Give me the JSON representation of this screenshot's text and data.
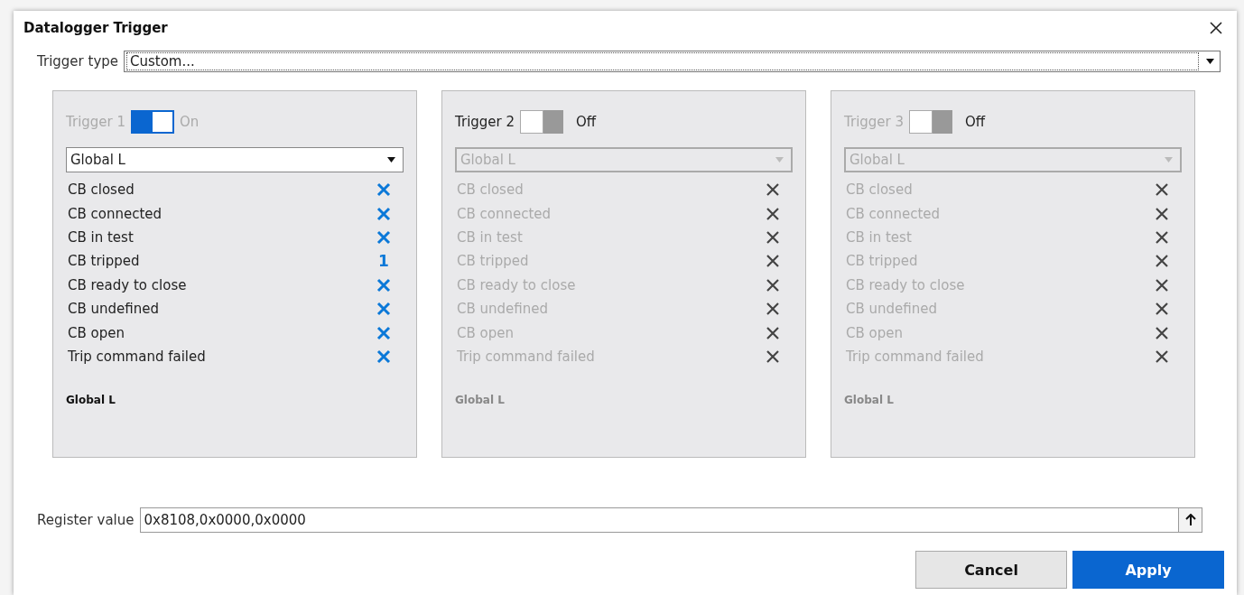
{
  "window": {
    "title": "Datalogger Trigger"
  },
  "trigger_type": {
    "label": "Trigger type",
    "value": "Custom..."
  },
  "triggers": [
    {
      "label": "Trigger 1",
      "label_active": false,
      "on": true,
      "state_text": "On",
      "source": "Global L",
      "conditions": [
        {
          "name": "CB closed",
          "kind": "x"
        },
        {
          "name": "CB connected",
          "kind": "x"
        },
        {
          "name": "CB in test",
          "kind": "x"
        },
        {
          "name": "CB tripped",
          "kind": "value",
          "value": "1"
        },
        {
          "name": "CB ready to close",
          "kind": "x"
        },
        {
          "name": "CB undefined",
          "kind": "x"
        },
        {
          "name": "CB open",
          "kind": "x"
        },
        {
          "name": "Trip command failed",
          "kind": "x"
        }
      ],
      "footer": "Global L"
    },
    {
      "label": "Trigger 2",
      "label_active": true,
      "on": false,
      "state_text": "Off",
      "source": "Global L",
      "conditions": [
        {
          "name": "CB closed",
          "kind": "x"
        },
        {
          "name": "CB connected",
          "kind": "x"
        },
        {
          "name": "CB in test",
          "kind": "x"
        },
        {
          "name": "CB tripped",
          "kind": "x"
        },
        {
          "name": "CB ready to close",
          "kind": "x"
        },
        {
          "name": "CB undefined",
          "kind": "x"
        },
        {
          "name": "CB open",
          "kind": "x"
        },
        {
          "name": "Trip command failed",
          "kind": "x"
        }
      ],
      "footer": "Global L"
    },
    {
      "label": "Trigger 3",
      "label_active": false,
      "on": false,
      "state_text": "Off",
      "source": "Global L",
      "conditions": [
        {
          "name": "CB closed",
          "kind": "x"
        },
        {
          "name": "CB connected",
          "kind": "x"
        },
        {
          "name": "CB in test",
          "kind": "x"
        },
        {
          "name": "CB tripped",
          "kind": "x"
        },
        {
          "name": "CB ready to close",
          "kind": "x"
        },
        {
          "name": "CB undefined",
          "kind": "x"
        },
        {
          "name": "CB open",
          "kind": "x"
        },
        {
          "name": "Trip command failed",
          "kind": "x"
        }
      ],
      "footer": "Global L"
    }
  ],
  "register": {
    "label": "Register value",
    "value": "0x8108,0x0000,0x0000"
  },
  "buttons": [
    {
      "label": "Cancel",
      "kind": "secondary"
    },
    {
      "label": "Apply",
      "kind": "primary"
    }
  ]
}
